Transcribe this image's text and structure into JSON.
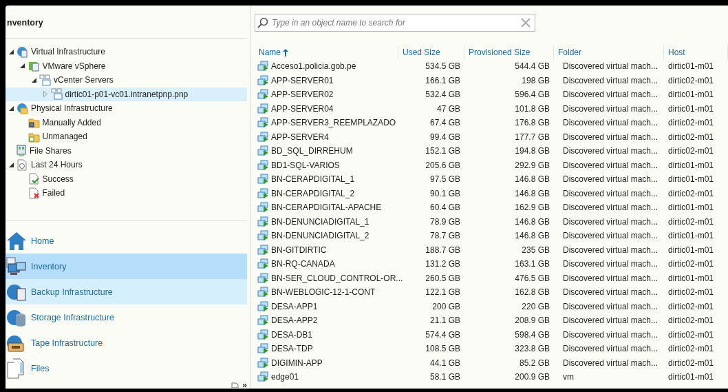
{
  "left_panel": {
    "title": "nventory",
    "tree": [
      {
        "label": "Virtual Infrastructure",
        "kind": "virtual",
        "expanded": true,
        "selected": false,
        "children": [
          {
            "label": "VMware vSphere",
            "kind": "vsphere",
            "expanded": true,
            "selected": false,
            "children": [
              {
                "label": "vCenter Servers",
                "kind": "vcenter",
                "expanded": true,
                "selected": false,
                "children": [
                  {
                    "label": "dirtic01-p01-vc01.intranetpnp.pnp",
                    "kind": "vcenter",
                    "expanded": false,
                    "selected": true
                  }
                ]
              }
            ]
          }
        ]
      },
      {
        "label": "Physical Infrastructure",
        "kind": "physical",
        "expanded": true,
        "selected": false,
        "children": [
          {
            "label": "Manually Added",
            "kind": "folder",
            "selected": false
          },
          {
            "label": "Unmanaged",
            "kind": "folder-v",
            "selected": false
          }
        ]
      },
      {
        "label": "File Shares",
        "kind": "share",
        "selected": false
      },
      {
        "label": "Last 24 Hours",
        "kind": "history",
        "expanded": true,
        "selected": false,
        "children": [
          {
            "label": "Success",
            "kind": "success",
            "selected": false
          },
          {
            "label": "Failed",
            "kind": "failed",
            "selected": false
          }
        ]
      }
    ],
    "nav": [
      {
        "label": "Home",
        "kind": "home",
        "selected": false,
        "hovered": false
      },
      {
        "label": "Inventory",
        "kind": "inventory",
        "selected": true,
        "hovered": false
      },
      {
        "label": "Backup Infrastructure",
        "kind": "backup",
        "selected": false,
        "hovered": true
      },
      {
        "label": "Storage Infrastructure",
        "kind": "storage",
        "selected": false,
        "hovered": false
      },
      {
        "label": "Tape Infrastructure",
        "kind": "tape",
        "selected": false,
        "hovered": false
      },
      {
        "label": "Files",
        "kind": "files",
        "selected": false,
        "hovered": false
      }
    ],
    "overflow": "»"
  },
  "search": {
    "placeholder": "Type in an object name to search for"
  },
  "table": {
    "columns": [
      {
        "label": "Name",
        "sorted": true
      },
      {
        "label": "Used Size",
        "sorted": false
      },
      {
        "label": "Provisioned Size",
        "sorted": false
      },
      {
        "label": "Folder",
        "sorted": false
      },
      {
        "label": "Host",
        "sorted": false
      }
    ],
    "rows": [
      [
        "Acceso1.policia.gob.pe",
        "534.5 GB",
        "544.4 GB",
        "Discovered virtual mach...",
        "dirtic01-m01"
      ],
      [
        "APP-SERVER01",
        "166.1 GB",
        "198 GB",
        "Discovered virtual mach...",
        "dirtic02-m01"
      ],
      [
        "APP-SERVER02",
        "532.4 GB",
        "596.4 GB",
        "Discovered virtual mach...",
        "dirtic01-m01"
      ],
      [
        "APP-SERVER04",
        "47 GB",
        "101.8 GB",
        "Discovered virtual mach...",
        "dirtic01-m01"
      ],
      [
        "APP-SERVER3_REEMPLAZADO",
        "67.4 GB",
        "176.8 GB",
        "Discovered virtual mach...",
        "dirtic02-m01"
      ],
      [
        "APP-SERVER4",
        "99.4 GB",
        "177.7 GB",
        "Discovered virtual mach...",
        "dirtic02-m01"
      ],
      [
        "BD_SQL_DIRREHUM",
        "152.1 GB",
        "194.8 GB",
        "Discovered virtual mach...",
        "dirtic02-m01"
      ],
      [
        "BD1-SQL-VARIOS",
        "205.6 GB",
        "292.9 GB",
        "Discovered virtual mach...",
        "dirtic01-m01"
      ],
      [
        "BN-CERAPDIGITAL_1",
        "97.5 GB",
        "146.8 GB",
        "Discovered virtual mach...",
        "dirtic01-m01"
      ],
      [
        "BN-CERAPDIGITAL_2",
        "90.1 GB",
        "146.8 GB",
        "Discovered virtual mach...",
        "dirtic02-m01"
      ],
      [
        "BN-CERAPDIGITAL-APACHE",
        "60.4 GB",
        "162.9 GB",
        "Discovered virtual mach...",
        "dirtic01-m01"
      ],
      [
        "BN-DENUNCIADIGITAL_1",
        "78.9 GB",
        "146.8 GB",
        "Discovered virtual mach...",
        "dirtic02-m01"
      ],
      [
        "BN-DENUNCIADIGITAL_2",
        "78.7 GB",
        "146.8 GB",
        "Discovered virtual mach...",
        "dirtic01-m01"
      ],
      [
        "BN-GITDIRTIC",
        "188.7 GB",
        "235 GB",
        "Discovered virtual mach...",
        "dirtic01-m01"
      ],
      [
        "BN-RQ-CANADA",
        "131.2 GB",
        "163.1 GB",
        "Discovered virtual mach...",
        "dirtic02-m01"
      ],
      [
        "BN-SER_CLOUD_CONTROL-OR...",
        "260.5 GB",
        "476.5 GB",
        "Discovered virtual mach...",
        "dirtic01-m01"
      ],
      [
        "BN-WEBLOGIC-12-1-CONT",
        "122.1 GB",
        "162.8 GB",
        "Discovered virtual mach...",
        "dirtic02-m01"
      ],
      [
        "DESA-APP1",
        "200 GB",
        "220 GB",
        "Discovered virtual mach...",
        "dirtic02-m01"
      ],
      [
        "DESA-APP2",
        "21.1 GB",
        "208.9 GB",
        "Discovered virtual mach...",
        "dirtic02-m01"
      ],
      [
        "DESA-DB1",
        "574.4 GB",
        "598.4 GB",
        "Discovered virtual mach...",
        "dirtic02-m01"
      ],
      [
        "DESA-TDP",
        "108.5 GB",
        "323.8 GB",
        "Discovered virtual mach...",
        "dirtic02-m01"
      ],
      [
        "DIGIMIN-APP",
        "44.1 GB",
        "85.2 GB",
        "Discovered virtual mach...",
        "dirtic02-m01"
      ],
      [
        "edge01",
        "58.1 GB",
        "200.9 GB",
        "vm",
        "dirtic01-m01"
      ]
    ]
  }
}
